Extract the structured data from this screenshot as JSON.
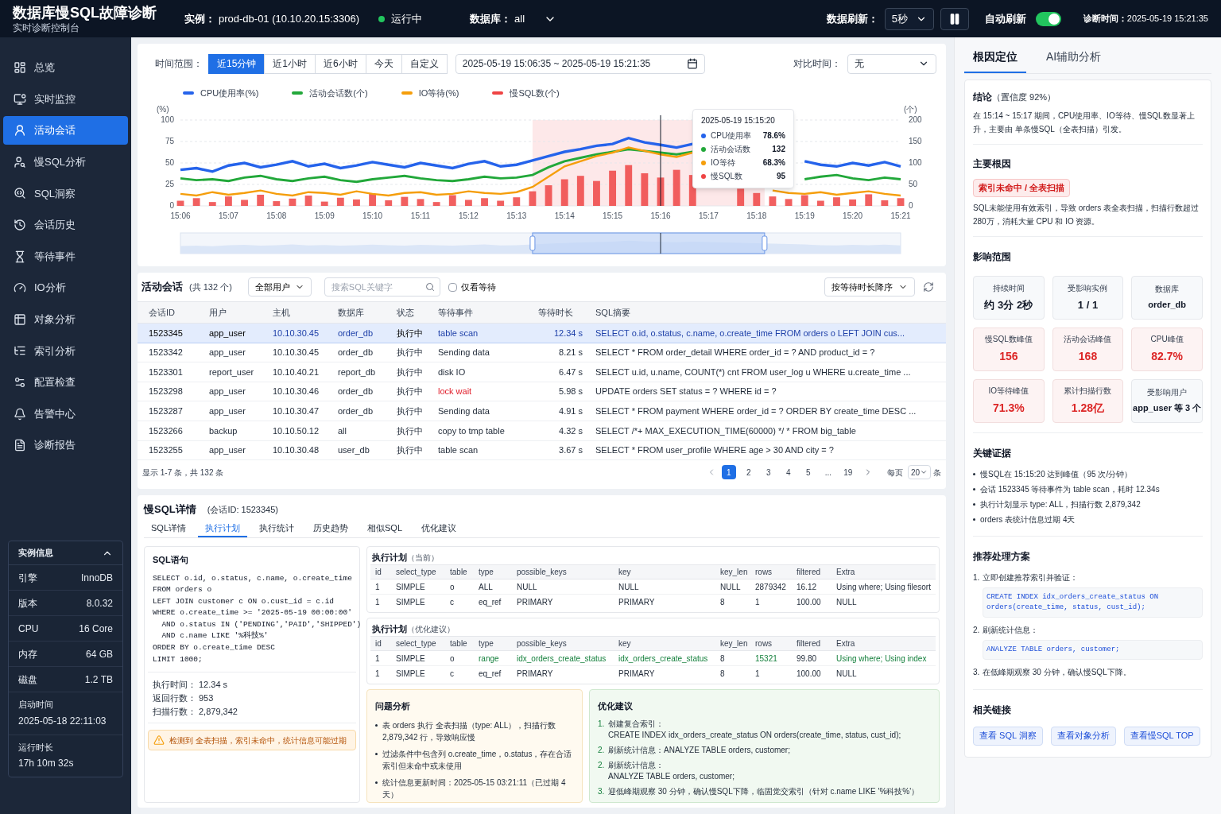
{
  "header": {
    "title": "数据库慢SQL故障诊断",
    "subtitle": "实时诊断控制台",
    "instance_label": "实例：",
    "instance": "prod-db-01 (10.10.20.15:3306)",
    "status": {
      "text": "运行中",
      "color": "#22c55e"
    },
    "database_label": "数据库：",
    "database": "all",
    "refresh_label": "数据刷新：",
    "refresh_interval": "5秒",
    "auto_refresh": {
      "label": "自动刷新",
      "on": true
    },
    "diagnosis_time_label": "诊断时间：",
    "diagnosis_time": "2025-05-19 15:21:35"
  },
  "sidebar": {
    "items": [
      {
        "label": "总览",
        "selected": false
      },
      {
        "label": "实时监控",
        "selected": false
      },
      {
        "label": "活动会话",
        "selected": true
      },
      {
        "label": "慢SQL分析",
        "selected": false
      },
      {
        "label": "SQL洞察",
        "selected": false
      },
      {
        "label": "会话历史",
        "selected": false
      },
      {
        "label": "等待事件",
        "selected": false
      },
      {
        "label": "IO分析",
        "selected": false
      },
      {
        "label": "对象分析",
        "selected": false
      },
      {
        "label": "索引分析",
        "selected": false
      },
      {
        "label": "配置检查",
        "selected": false
      },
      {
        "label": "告警中心",
        "selected": false
      },
      {
        "label": "诊断报告",
        "selected": false
      }
    ],
    "instance_info": {
      "title": "实例信息",
      "expanded": true,
      "rows": [
        {
          "kind": "pair",
          "label": "引擎",
          "value": "InnoDB"
        },
        {
          "kind": "pair",
          "label": "版本",
          "value": "8.0.32"
        },
        {
          "kind": "pair",
          "label": "CPU",
          "value": "16 Core"
        },
        {
          "kind": "pair",
          "label": "内存",
          "value": "64 GB"
        },
        {
          "kind": "pair",
          "label": "磁盘",
          "value": "1.2 TB"
        },
        {
          "kind": "stacked",
          "label": "启动时间",
          "value": "2025-05-18 22:11:03"
        },
        {
          "kind": "stacked",
          "label": "运行时长",
          "value": "17h 10m 32s"
        }
      ]
    }
  },
  "chart_panel": {
    "time_range_label": "时间范围：",
    "ranges": [
      {
        "label": "近15分钟",
        "selected": true
      },
      {
        "label": "近1小时",
        "selected": false
      },
      {
        "label": "近6小时",
        "selected": false
      },
      {
        "label": "今天",
        "selected": false
      },
      {
        "label": "自定义",
        "selected": false
      }
    ],
    "date_range": "2025-05-19 15:06:35 ~ 2025-05-19 15:21:35",
    "compare_label": "对比时间：",
    "compare_value": "无",
    "chart_data": {
      "type": "line",
      "ylabel": "(%)",
      "y2label": "(个)",
      "ylim": [
        0,
        100
      ],
      "y2lim": [
        0,
        200
      ],
      "categories": [
        "15:06",
        null,
        null,
        "15:07",
        null,
        null,
        "15:08",
        null,
        null,
        "15:09",
        null,
        null,
        "15:10",
        null,
        null,
        "15:11",
        null,
        null,
        "15:12",
        null,
        null,
        "15:13",
        null,
        null,
        "15:14",
        null,
        null,
        "15:15",
        null,
        null,
        "15:16",
        null,
        null,
        "15:17",
        null,
        null,
        "15:18",
        null,
        null,
        "15:19",
        null,
        null,
        "15:20",
        null,
        null,
        "15:21"
      ],
      "yticks": [
        0,
        25,
        50,
        75,
        100
      ],
      "y2ticks": [
        0,
        50,
        100,
        150,
        200
      ],
      "series": [
        {
          "name": "CPU使用率(%)",
          "color": "#2563eb",
          "values": [
            42,
            44,
            40,
            47,
            50,
            45,
            48,
            52,
            46,
            49,
            44,
            47,
            51,
            48,
            45,
            50,
            47,
            44,
            49,
            52,
            46,
            48,
            53,
            58,
            63,
            66,
            70,
            72,
            79,
            74,
            71,
            68,
            72,
            null,
            null,
            null,
            null,
            null,
            null,
            52,
            48,
            46,
            50,
            47,
            51,
            46
          ]
        },
        {
          "name": "活动会话数(个)",
          "color": "#22a83a",
          "axis": "y2",
          "values": [
            64,
            60,
            62,
            58,
            66,
            70,
            62,
            58,
            64,
            68,
            60,
            56,
            62,
            66,
            70,
            64,
            60,
            58,
            62,
            68,
            64,
            66,
            72,
            90,
            104,
            112,
            120,
            126,
            132,
            128,
            124,
            120,
            126,
            null,
            null,
            null,
            null,
            null,
            null,
            62,
            68,
            72,
            64,
            60,
            66,
            62
          ]
        },
        {
          "name": "IO等待(%)",
          "color": "#f59e0b",
          "values": [
            14,
            12,
            16,
            13,
            15,
            18,
            14,
            12,
            16,
            15,
            13,
            17,
            14,
            12,
            15,
            16,
            13,
            14,
            17,
            15,
            14,
            16,
            22,
            34,
            46,
            52,
            58,
            62,
            68,
            64,
            60,
            57,
            62,
            null,
            null,
            null,
            null,
            18,
            15,
            14,
            16,
            13,
            15,
            17,
            14,
            12
          ]
        },
        {
          "name": "慢SQL数(个)",
          "color": "#ef4444",
          "type": "bar",
          "axis": "y2",
          "values": [
            12,
            18,
            9,
            22,
            14,
            26,
            11,
            17,
            24,
            10,
            19,
            15,
            28,
            13,
            21,
            16,
            9,
            25,
            14,
            18,
            12,
            20,
            34,
            48,
            62,
            70,
            58,
            82,
            95,
            76,
            66,
            84,
            72,
            null,
            null,
            40,
            30,
            22,
            16,
            25,
            12,
            20,
            15,
            27,
            13,
            18
          ]
        }
      ],
      "ref_lines": [
        {
          "axis": "x",
          "value": "15:16"
        }
      ],
      "grid": true,
      "legend": true
    },
    "tooltip": {
      "title": "2025-05-19 15:15:20",
      "items": [
        {
          "label": "CPU使用率",
          "value": "78.6%",
          "color": "#2563eb"
        },
        {
          "label": "活动会话数",
          "value": "132",
          "color": "#22a83a"
        },
        {
          "label": "IO等待",
          "value": "68.3%",
          "color": "#f59e0b"
        },
        {
          "label": "慢SQL数",
          "value": "95",
          "color": "#ef4444"
        }
      ]
    }
  },
  "sessions": {
    "title": "活动会话",
    "count": "(共 132 个)",
    "user_filter": "全部用户",
    "search_placeholder": "搜索SQL关键字",
    "wait_only": {
      "label": "仅看等待",
      "checked": false
    },
    "sort": "按等待时长降序",
    "columns": [
      "会话ID",
      "用户",
      "主机",
      "数据库",
      "状态",
      "等待事件",
      "等待时长",
      "SQL摘要"
    ],
    "rows": [
      {
        "selected": true,
        "alert": false,
        "cells": [
          "1523345",
          "app_user",
          "10.10.30.45",
          "order_db",
          "执行中",
          "table scan",
          "12.34 s",
          "SELECT o.id, o.status, c.name, o.create_time FROM orders o LEFT JOIN cus..."
        ]
      },
      {
        "selected": false,
        "alert": false,
        "cells": [
          "1523342",
          "app_user",
          "10.10.30.45",
          "order_db",
          "执行中",
          "Sending data",
          "8.21 s",
          "SELECT * FROM order_detail WHERE order_id = ? AND product_id = ?"
        ]
      },
      {
        "selected": false,
        "alert": false,
        "cells": [
          "1523301",
          "report_user",
          "10.10.40.21",
          "report_db",
          "执行中",
          "disk IO",
          "6.47 s",
          "SELECT u.id, u.name, COUNT(*) cnt FROM user_log u WHERE u.create_time ..."
        ]
      },
      {
        "selected": false,
        "alert": true,
        "cells": [
          "1523298",
          "app_user",
          "10.10.30.46",
          "order_db",
          "执行中",
          "lock wait",
          "5.98 s",
          "UPDATE orders SET status = ? WHERE id = ?"
        ]
      },
      {
        "selected": false,
        "alert": false,
        "cells": [
          "1523287",
          "app_user",
          "10.10.30.47",
          "order_db",
          "执行中",
          "Sending data",
          "4.91 s",
          "SELECT * FROM payment WHERE order_id = ? ORDER BY create_time DESC ..."
        ]
      },
      {
        "selected": false,
        "alert": false,
        "cells": [
          "1523266",
          "backup",
          "10.10.50.12",
          "all",
          "执行中",
          "copy to tmp table",
          "4.32 s",
          "SELECT /*+ MAX_EXECUTION_TIME(60000) */ * FROM big_table"
        ]
      },
      {
        "selected": false,
        "alert": false,
        "cells": [
          "1523255",
          "app_user",
          "10.10.30.48",
          "user_db",
          "执行中",
          "table scan",
          "3.67 s",
          "SELECT * FROM user_profile WHERE age > 30 AND city = ?"
        ]
      }
    ],
    "summary": "显示 1-7 条，共 132 条",
    "pages": [
      {
        "label": "1",
        "selected": true
      },
      {
        "label": "2",
        "selected": false
      },
      {
        "label": "3",
        "selected": false
      },
      {
        "label": "4",
        "selected": false
      },
      {
        "label": "5",
        "selected": false
      },
      {
        "label": "...",
        "selected": false
      },
      {
        "label": "19",
        "selected": false
      }
    ],
    "per_page_label": "每页",
    "per_page": "20",
    "per_page_unit": "条"
  },
  "detail": {
    "title": "慢SQL详情",
    "session": "(会话ID: 1523345)",
    "tabs": [
      {
        "label": "SQL详情",
        "selected": false
      },
      {
        "label": "执行计划",
        "selected": true
      },
      {
        "label": "执行统计",
        "selected": false
      },
      {
        "label": "历史趋势",
        "selected": false
      },
      {
        "label": "相似SQL",
        "selected": false
      },
      {
        "label": "优化建议",
        "selected": false
      }
    ],
    "sql": {
      "title": "SQL语句",
      "lines": [
        "SELECT o.id, o.status, c.name, o.create_time",
        "FROM orders o",
        "LEFT JOIN customer c ON o.cust_id = c.id",
        "WHERE o.create_time >= '2025-05-19 00:00:00'",
        "  AND o.status IN ('PENDING','PAID','SHIPPED')",
        "  AND c.name LIKE '%科技%'",
        "ORDER BY o.create_time DESC",
        "LIMIT 1000;"
      ],
      "stats": [
        {
          "label": "执行时间：",
          "value": "12.34 s"
        },
        {
          "label": "返回行数：",
          "value": "953"
        },
        {
          "label": "扫描行数：",
          "value": "2,879,342"
        }
      ],
      "warning": "检测到 全表扫描，索引未命中，统计信息可能过期"
    },
    "plans": [
      {
        "title": "执行计划",
        "note": "（当前）",
        "columns": [
          "id",
          "select_type",
          "table",
          "type",
          "possible_keys",
          "key",
          "key_len",
          "rows",
          "filtered",
          "Extra"
        ],
        "rows": [
          [
            {
              "text": "1",
              "improved": false
            },
            {
              "text": "SIMPLE",
              "improved": false
            },
            {
              "text": "o",
              "improved": false
            },
            {
              "text": "ALL",
              "improved": false
            },
            {
              "text": "NULL",
              "improved": false
            },
            {
              "text": "NULL",
              "improved": false
            },
            {
              "text": "NULL",
              "improved": false
            },
            {
              "text": "2879342",
              "improved": false
            },
            {
              "text": "16.12",
              "improved": false
            },
            {
              "text": "Using where; Using filesort",
              "improved": false
            }
          ],
          [
            {
              "text": "1",
              "improved": false
            },
            {
              "text": "SIMPLE",
              "improved": false
            },
            {
              "text": "c",
              "improved": false
            },
            {
              "text": "eq_ref",
              "improved": false
            },
            {
              "text": "PRIMARY",
              "improved": false
            },
            {
              "text": "PRIMARY",
              "improved": false
            },
            {
              "text": "8",
              "improved": false
            },
            {
              "text": "1",
              "improved": false
            },
            {
              "text": "100.00",
              "improved": false
            },
            {
              "text": "NULL",
              "improved": false
            }
          ]
        ]
      },
      {
        "title": "执行计划",
        "note": "（优化建议）",
        "columns": [
          "id",
          "select_type",
          "table",
          "type",
          "possible_keys",
          "key",
          "key_len",
          "rows",
          "filtered",
          "Extra"
        ],
        "rows": [
          [
            {
              "text": "1",
              "improved": false
            },
            {
              "text": "SIMPLE",
              "improved": false
            },
            {
              "text": "o",
              "improved": false
            },
            {
              "text": "range",
              "improved": true
            },
            {
              "text": "idx_orders_create_status",
              "improved": true
            },
            {
              "text": "idx_orders_create_status",
              "improved": true
            },
            {
              "text": "8",
              "improved": false
            },
            {
              "text": "15321",
              "improved": true
            },
            {
              "text": "99.80",
              "improved": false
            },
            {
              "text": "Using where; Using index",
              "improved": true
            }
          ],
          [
            {
              "text": "1",
              "improved": false
            },
            {
              "text": "SIMPLE",
              "improved": false
            },
            {
              "text": "c",
              "improved": false
            },
            {
              "text": "eq_ref",
              "improved": false
            },
            {
              "text": "PRIMARY",
              "improved": false
            },
            {
              "text": "PRIMARY",
              "improved": false
            },
            {
              "text": "8",
              "improved": false
            },
            {
              "text": "1",
              "improved": false
            },
            {
              "text": "100.00",
              "improved": false
            },
            {
              "text": "NULL",
              "improved": false
            }
          ]
        ]
      }
    ],
    "problem": {
      "title": "问题分析",
      "bullets": [
        "表 orders 执行 全表扫描（type: ALL），扫描行数 2,879,342 行，导致响应慢",
        "过滤条件中包含列 o.create_time，o.status，存在合适索引但未命中或未使用",
        "统计信息更新时间：2025-05-15 03:21:11（已过期 4天）"
      ]
    },
    "optimization": {
      "title": "优化建议",
      "items": [
        {
          "number": "1.",
          "text": "创建复合索引：",
          "code": "CREATE INDEX idx_orders_create_status ON orders(create_time, status, cust_id);"
        },
        {
          "number": "2.",
          "text": "刷新统计信息：ANALYZE TABLE orders, customer;"
        },
        {
          "number": "2.",
          "text": "刷新统计信息：",
          "code": "ANALYZE TABLE orders, customer;"
        },
        {
          "number": "3.",
          "text": "迎低峰期观察 30 分钟，确认慢SQL下降，临固觉交索引（针对 c.name LIKE '%科技%'）"
        }
      ]
    }
  },
  "right_panel": {
    "tabs": [
      {
        "label": "根因定位",
        "selected": true
      },
      {
        "label": "AI辅助分析",
        "selected": false
      }
    ],
    "conclusion": {
      "title": "结论",
      "confidence": "（置信度 92%）",
      "text": "在 15:14 ~ 15:17 期间，CPU使用率、IO等待、慢SQL数显著上升，主要由 单条慢SQL（全表扫描）引发。"
    },
    "root_cause": {
      "title": "主要根因",
      "tag": "索引未命中 / 全表扫描",
      "text": "SQL未能使用有效索引，导致 orders 表全表扫描，扫描行数超过 280万，消耗大量 CPU 和 IO 资源。"
    },
    "impact": {
      "title": "影响范围",
      "tiles": [
        {
          "label": "持续时间",
          "value": "约 3分 2秒",
          "alert": false
        },
        {
          "label": "受影响实例",
          "value": "1 / 1",
          "alert": false
        },
        {
          "label": "数据库",
          "value": "order_db",
          "alert": false
        },
        {
          "label": "慢SQL数峰值",
          "value": "156",
          "alert": true
        },
        {
          "label": "活动会话峰值",
          "value": "168",
          "alert": true
        },
        {
          "label": "CPU峰值",
          "value": "82.7%",
          "alert": true
        },
        {
          "label": "IO等待峰值",
          "value": "71.3%",
          "alert": true
        },
        {
          "label": "累计扫描行数",
          "value": "1.28亿",
          "alert": true
        },
        {
          "label": "受影响用户",
          "value": "app_user 等 3 个",
          "alert": false
        }
      ]
    },
    "evidence": {
      "title": "关键证据",
      "bullets": [
        "慢SQL在 15:15:20 达到峰值（95 次/分钟）",
        "会话 1523345 等待事件为 table scan，耗时 12.34s",
        "执行计划显示 type: ALL，扫描行数 2,879,342",
        "orders 表统计信息过期 4天"
      ]
    },
    "plan": {
      "title": "推荐处理方案",
      "steps": [
        {
          "number": "1.",
          "text": "立即创建推荐索引并验证：",
          "code": [
            "CREATE INDEX idx_orders_create_status ON",
            "orders(create_time, status, cust_id);"
          ]
        },
        {
          "number": "2.",
          "text": "刷新统计信息：",
          "code": [
            "ANALYZE TABLE orders, customer;"
          ]
        },
        {
          "number": "3.",
          "text": "在低峰期观察 30 分钟，确认慢SQL下降。"
        }
      ]
    },
    "links": {
      "title": "相关链接",
      "items": [
        "查看 SQL 洞察",
        "查看对象分析",
        "查看慢SQL TOP"
      ]
    }
  }
}
